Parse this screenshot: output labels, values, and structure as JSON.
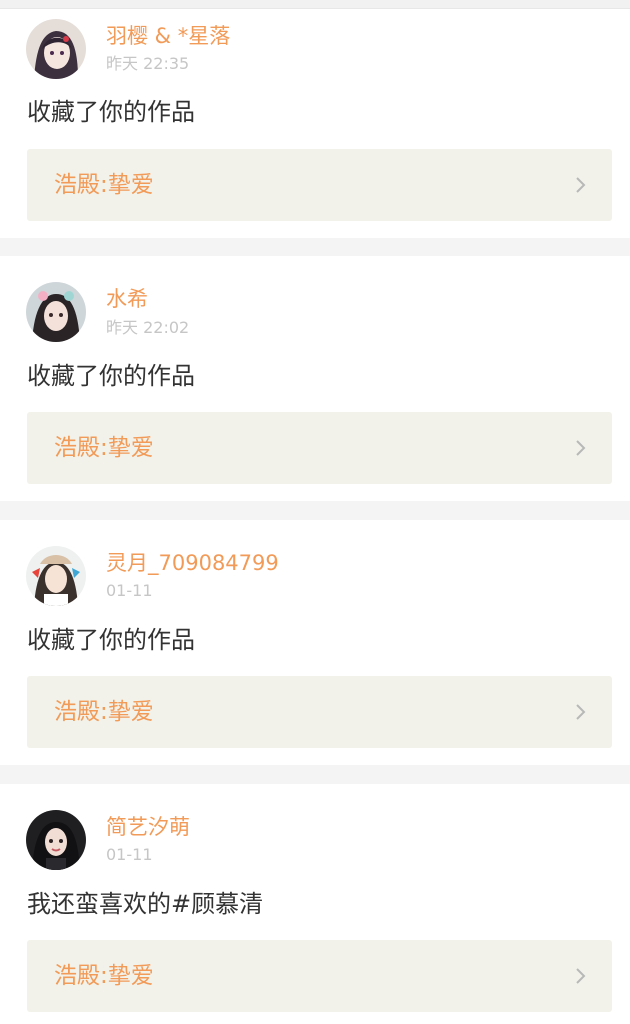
{
  "feed": {
    "items": [
      {
        "user": "羽樱 & *星落",
        "time": "昨天 22:35",
        "message": "收藏了你的作品",
        "work": "浩殿:挚爱",
        "avatar_icon": "user-avatar-icon"
      },
      {
        "user": "水希",
        "time": "昨天 22:02",
        "message": "收藏了你的作品",
        "work": "浩殿:挚爱",
        "avatar_icon": "user-avatar-icon"
      },
      {
        "user": "灵月_709084799",
        "time": "01-11",
        "message": "收藏了你的作品",
        "work": "浩殿:挚爱",
        "avatar_icon": "user-avatar-icon"
      },
      {
        "user": "简艺汐萌",
        "time": "01-11",
        "message": "我还蛮喜欢的#顾慕清",
        "work": "浩殿:挚爱",
        "avatar_icon": "user-avatar-icon"
      }
    ]
  },
  "colors": {
    "accent": "#f29a57",
    "text": "#333333",
    "muted": "#c6c6c6",
    "link_bg": "#f2f2eb",
    "page_bg": "#f4f4f4"
  },
  "icons": {
    "chevron": "chevron-right-icon"
  }
}
